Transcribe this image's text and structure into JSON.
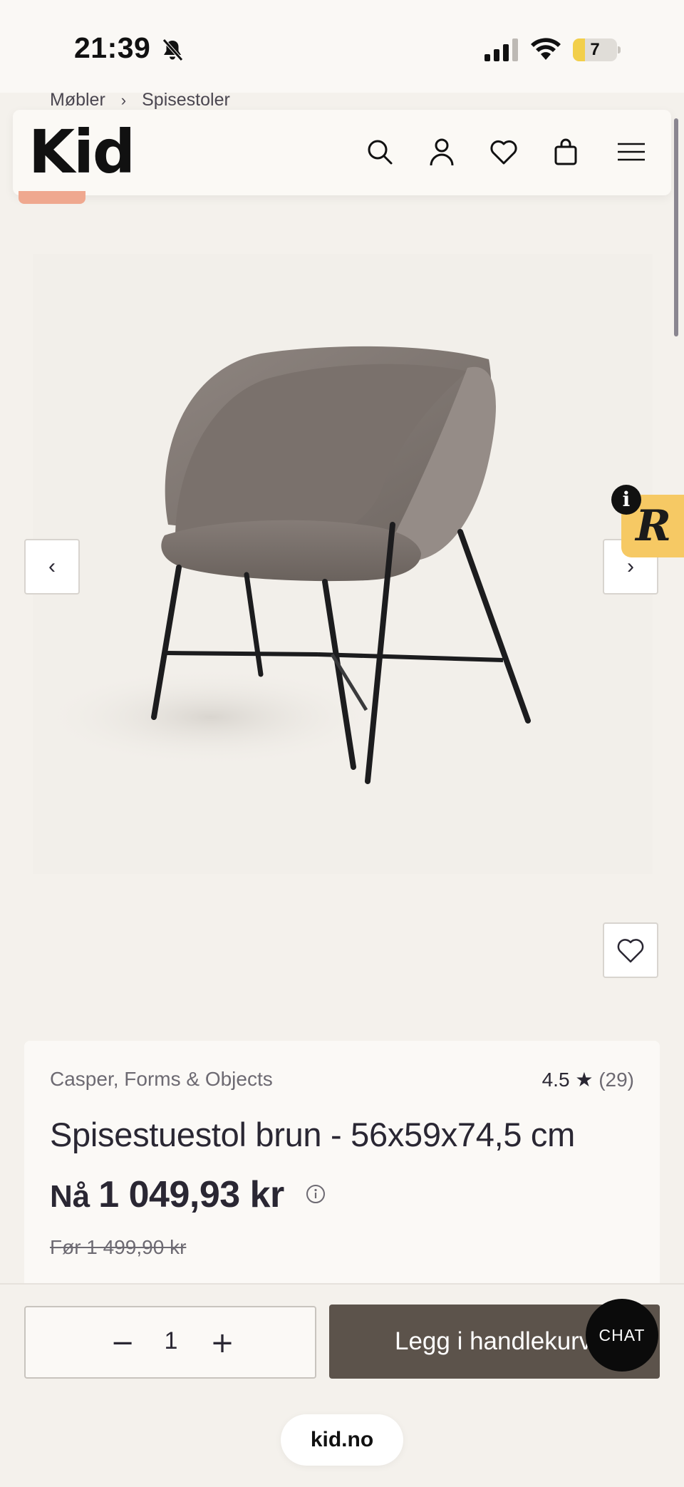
{
  "status_bar": {
    "time": "21:39",
    "battery": "7",
    "battery_level": 0.07
  },
  "breadcrumb": {
    "items": [
      "Møbler",
      "Spisestoler"
    ],
    "separator": "›"
  },
  "header": {
    "logo": "Kid",
    "icons": [
      "search-icon",
      "account-icon",
      "wishlist-heart-icon",
      "shopping-bag-icon",
      "menu-icon"
    ]
  },
  "gallery": {
    "prev_label": "‹",
    "next_label": "›",
    "image": "grey upholstered dining chair with black metal legs"
  },
  "badge": {
    "letter": "R",
    "info": "i"
  },
  "product": {
    "brand": "Casper, Forms & Objects",
    "rating": "4.5 ★",
    "rating_count": "(29)",
    "title": "Spisestuestol brun - 56x59x74,5 cm",
    "price_label": "Nå",
    "price": "1 049,93 kr",
    "old_price": "Før 1 499,90 kr"
  },
  "purchase": {
    "minus": "−",
    "quantity": "1",
    "plus": "+",
    "add_to_cart": "Legg i handlekurv",
    "chat": "CHAT"
  },
  "browser": {
    "url": "kid.no"
  },
  "colors": {
    "accent_button": "#5c534b",
    "sale_tab": "#efa88f",
    "badge": "#f6c964",
    "background": "#f4f1ec"
  }
}
